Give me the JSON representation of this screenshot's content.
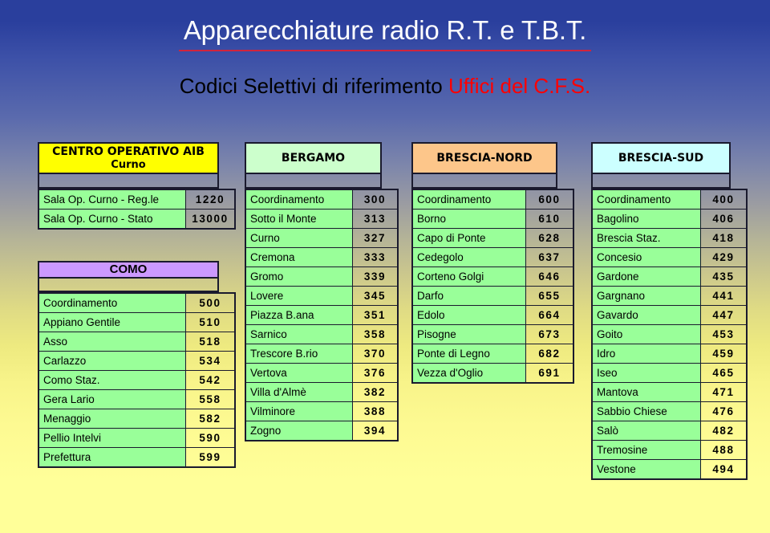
{
  "title": {
    "main": "Apparecchiature radio R.T. e T.B.T.",
    "subtitle_black": "Codici Selettivi di riferimento ",
    "subtitle_red": "Uffici del C.F.S.",
    "underline_color": "#d0243c",
    "main_color": "#ffffff",
    "red_color": "#ff0000"
  },
  "columns": [
    {
      "header": {
        "line1": "CENTRO OPERATIVO AIB",
        "line2": "Curno",
        "color": "#ffff00"
      },
      "rows": [
        {
          "name": "Sala Op. Curno - Reg.le",
          "code": "1220"
        },
        {
          "name": "Sala Op. Curno - Stato",
          "code": "13000"
        }
      ],
      "section": {
        "header": "COMO",
        "header_color": "#cc99ff",
        "rows": [
          {
            "name": "Coordinamento",
            "code": "500"
          },
          {
            "name": "Appiano Gentile",
            "code": "510"
          },
          {
            "name": "Asso",
            "code": "518"
          },
          {
            "name": "Carlazzo",
            "code": "534"
          },
          {
            "name": "Como Staz.",
            "code": "542"
          },
          {
            "name": "Gera Lario",
            "code": "558"
          },
          {
            "name": "Menaggio",
            "code": "582"
          },
          {
            "name": "Pellio Intelvi",
            "code": "590"
          },
          {
            "name": "Prefettura",
            "code": "599"
          }
        ]
      }
    },
    {
      "header": {
        "line1": "BERGAMO",
        "line2": "",
        "color": "#ccffcc"
      },
      "rows": [
        {
          "name": "Coordinamento",
          "code": "300"
        },
        {
          "name": "Sotto il Monte",
          "code": "313"
        },
        {
          "name": "Curno",
          "code": "327"
        },
        {
          "name": "Cremona",
          "code": "333"
        },
        {
          "name": "Gromo",
          "code": "339"
        },
        {
          "name": "Lovere",
          "code": "345"
        },
        {
          "name": "Piazza B.ana",
          "code": "351"
        },
        {
          "name": "Sarnico",
          "code": "358"
        },
        {
          "name": "Trescore B.rio",
          "code": "370"
        },
        {
          "name": "Vertova",
          "code": "376"
        },
        {
          "name": "Villa d'Almè",
          "code": "382"
        },
        {
          "name": "Vilminore",
          "code": "388"
        },
        {
          "name": "Zogno",
          "code": "394"
        }
      ]
    },
    {
      "header": {
        "line1": "BRESCIA-NORD",
        "line2": "",
        "color": "#fdc68a"
      },
      "rows": [
        {
          "name": "Coordinamento",
          "code": "600"
        },
        {
          "name": "Borno",
          "code": "610"
        },
        {
          "name": "Capo di Ponte",
          "code": "628"
        },
        {
          "name": "Cedegolo",
          "code": "637"
        },
        {
          "name": "Corteno Golgi",
          "code": "646"
        },
        {
          "name": "Darfo",
          "code": "655"
        },
        {
          "name": "Edolo",
          "code": "664"
        },
        {
          "name": "Pisogne",
          "code": "673"
        },
        {
          "name": "Ponte di Legno",
          "code": "682"
        },
        {
          "name": "Vezza d'Oglio",
          "code": "691"
        }
      ]
    },
    {
      "header": {
        "line1": "BRESCIA-SUD",
        "line2": "",
        "color": "#ccffff"
      },
      "rows": [
        {
          "name": "Coordinamento",
          "code": "400"
        },
        {
          "name": "Bagolino",
          "code": "406"
        },
        {
          "name": "Brescia Staz.",
          "code": "418"
        },
        {
          "name": "Concesio",
          "code": "429"
        },
        {
          "name": "Gardone",
          "code": "435"
        },
        {
          "name": "Gargnano",
          "code": "441"
        },
        {
          "name": "Gavardo",
          "code": "447"
        },
        {
          "name": "Goito",
          "code": "453"
        },
        {
          "name": "Idro",
          "code": "459"
        },
        {
          "name": "Iseo",
          "code": "465"
        },
        {
          "name": "Mantova",
          "code": "471"
        },
        {
          "name": "Sabbio Chiese",
          "code": "476"
        },
        {
          "name": "Salò",
          "code": "482"
        },
        {
          "name": "Tremosine",
          "code": "488"
        },
        {
          "name": "Vestone",
          "code": "494"
        }
      ]
    }
  ]
}
